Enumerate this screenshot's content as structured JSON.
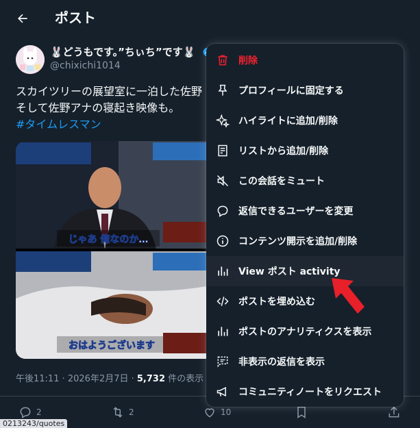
{
  "header": {
    "title": "ポスト",
    "back_icon": "arrow-left-icon"
  },
  "author": {
    "display_name": "🐰どうもです。”ちぃち”です🐰",
    "handle": "@chixichi1014"
  },
  "tweet": {
    "line1": "スカイツリーの展望室に一泊した佐野",
    "line2": "そして佐野アナの寝起き映像も。",
    "hashtag": "#タイムレスマン",
    "subtitle_top": "じゃあ 俺なのか…",
    "subtitle_bottom": "おはようございます"
  },
  "meta": {
    "time_date": "午後11:11 · 2026年2月7日 · ",
    "views": "5,732",
    "views_suffix": " 件の表示"
  },
  "actions": {
    "replies": "2",
    "retweets": "2",
    "likes": "10"
  },
  "status_bar": {
    "url": "0213243/quotes"
  },
  "menu": {
    "items": [
      {
        "label": "削除",
        "icon": "trash-icon"
      },
      {
        "label": "プロフィールに固定する",
        "icon": "pin-icon"
      },
      {
        "label": "ハイライトに追加/削除",
        "icon": "sparkle-icon"
      },
      {
        "label": "リストから追加/削除",
        "icon": "list-icon"
      },
      {
        "label": "この会話をミュート",
        "icon": "mute-icon"
      },
      {
        "label": "返信できるユーザーを変更",
        "icon": "reply-bubble-icon"
      },
      {
        "label": "コンテンツ開示を追加/削除",
        "icon": "info-icon"
      },
      {
        "label": "View ポスト activity",
        "icon": "activity-bars-icon"
      },
      {
        "label": "ポストを埋め込む",
        "icon": "embed-code-icon"
      },
      {
        "label": "ポストのアナリティクスを表示",
        "icon": "analytics-bars-icon"
      },
      {
        "label": "非表示の返信を表示",
        "icon": "hidden-replies-icon"
      },
      {
        "label": "コミュニティノートをリクエスト",
        "icon": "megaphone-icon"
      }
    ]
  },
  "colors": {
    "background": "#15202b",
    "danger": "#f4212e",
    "link": "#1d9bf0",
    "secondary_text": "#8b98a5",
    "arrow": "#e8202a"
  }
}
